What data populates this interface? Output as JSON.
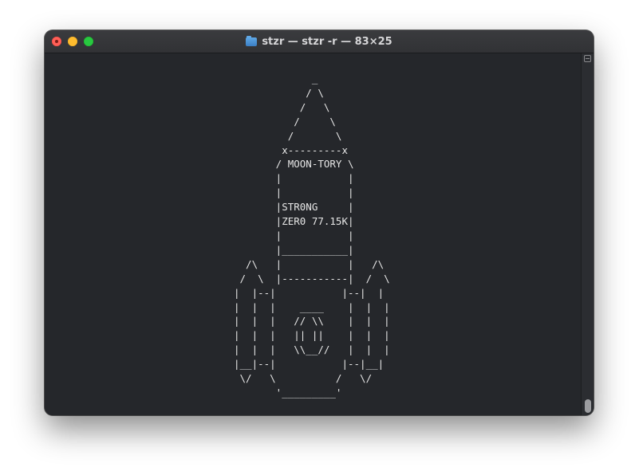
{
  "window": {
    "title": "stzr — stzr -r — 83×25",
    "controls": [
      "close",
      "minimize",
      "zoom"
    ],
    "title_icon": "folder-icon"
  },
  "terminal": {
    "background": "#25272b",
    "text_color": "#e6e6e6",
    "art_lines": [
      "      _",
      "     / \\",
      "    /   \\",
      "   /     \\",
      "  /       \\",
      " x---------x",
      "/ MOON-TORY \\",
      "|           |",
      "|           |",
      "|STR0NG     |",
      "|ZER0 77.15K|",
      "|           |",
      "|___________|",
      "|           |",
      "|-----------|",
      "|           |",
      "|   ____    |",
      "|  // \\\\    |",
      "|  || ||    |",
      "|  \\\\__//   |",
      "|           |",
      "\\          /",
      " '_________'"
    ],
    "art": "             _\n            / \\\n           /   \\\n          /     \\\n         /       \\\n        x---------x\n       / MOON-TORY \\\n       |           |\n       |           |\n       |STR0NG     |\n       |ZER0 77.15K|\n       |           |\n       |___________|\n  /\\   |           |   /\\\n /  \\  |-----------|  /  \\\n|  |--|           |--|  |\n|  |  |    ____    |  |  |\n|  |  |   // \\\\    |  |  |\n|  |  |   || ||    |  |  |\n|  |  |   \\\\__//   |  |  |\n|__|--|           |--|__|\n \\/   \\          /   \\/\n       '_________'"
  }
}
